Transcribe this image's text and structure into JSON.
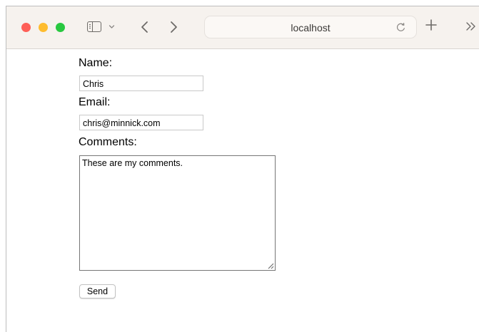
{
  "browser": {
    "address": "localhost",
    "icons": {
      "close": "close-window-icon",
      "minimize": "minimize-window-icon",
      "zoom": "zoom-window-icon",
      "sidebar": "sidebar-icon",
      "sidebar_menu": "chevron-down-icon",
      "back": "chevron-left-icon",
      "forward": "chevron-right-icon",
      "reload": "reload-icon",
      "new_tab": "plus-icon",
      "more": "double-chevron-right-icon"
    },
    "colors": {
      "close": "#fe5f57",
      "minimize": "#febc2e",
      "zoom": "#28c840",
      "toolbar_bg": "#f6f2ee"
    }
  },
  "form": {
    "name_label": "Name:",
    "name_value": "Chris",
    "email_label": "Email:",
    "email_value": "chris@minnick.com",
    "comments_label": "Comments:",
    "comments_value": "These are my comments.",
    "send_label": "Send"
  }
}
